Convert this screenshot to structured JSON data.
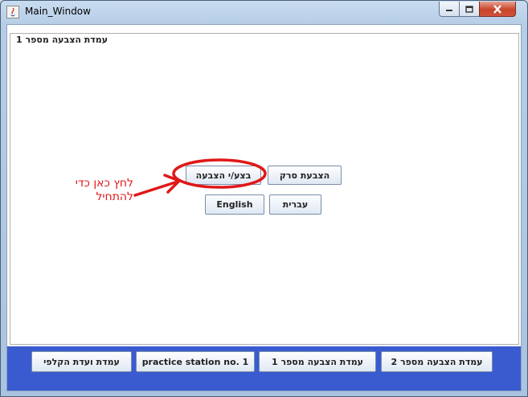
{
  "window": {
    "title": "Main_Window",
    "controls": {
      "minimize": "minimize-icon",
      "maximize": "maximize-icon",
      "close": "close-icon"
    }
  },
  "panel": {
    "legend": "עמדת הצבעה מספר 1"
  },
  "buttons": {
    "vote": "בצע/י הצבעה",
    "scan_vote": "הצבעת סרק",
    "english": "English",
    "hebrew": "עברית"
  },
  "annotation": {
    "text": "לחץ כאן כדי להתחיל",
    "color": "#e01818"
  },
  "bottom_bar": {
    "color": "#3a5bd0",
    "buttons": [
      "עמדת ועדת הקלפי",
      "practice station no. 1",
      "עמדת הצבעה מספר 1",
      "עמדת הצבעה מספר 2"
    ]
  }
}
